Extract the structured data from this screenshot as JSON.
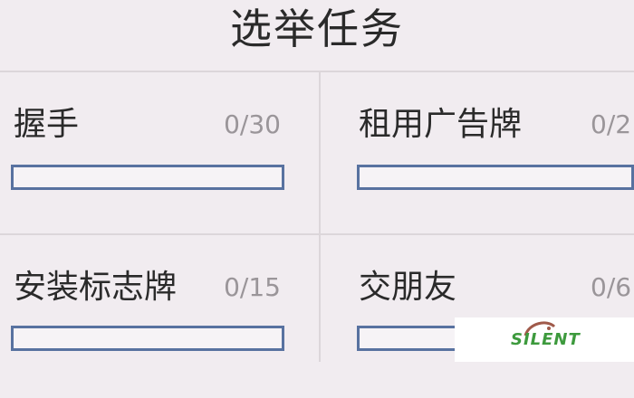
{
  "title": "选举任务",
  "tasks": [
    {
      "name": "握手",
      "count": "0/30",
      "progress": 0
    },
    {
      "name": "租用广告牌",
      "count": "0/2",
      "progress": 0
    },
    {
      "name": "安装标志牌",
      "count": "0/15",
      "progress": 0
    },
    {
      "name": "交朋友",
      "count": "0/6",
      "progress": 0
    }
  ],
  "watermark": {
    "text": "SILENT"
  },
  "colors": {
    "background": "#f1ecf0",
    "bar_border": "#5872a0",
    "divider": "#dcd6da",
    "count_text": "#9a9599",
    "watermark_green": "#3d9a3d"
  }
}
